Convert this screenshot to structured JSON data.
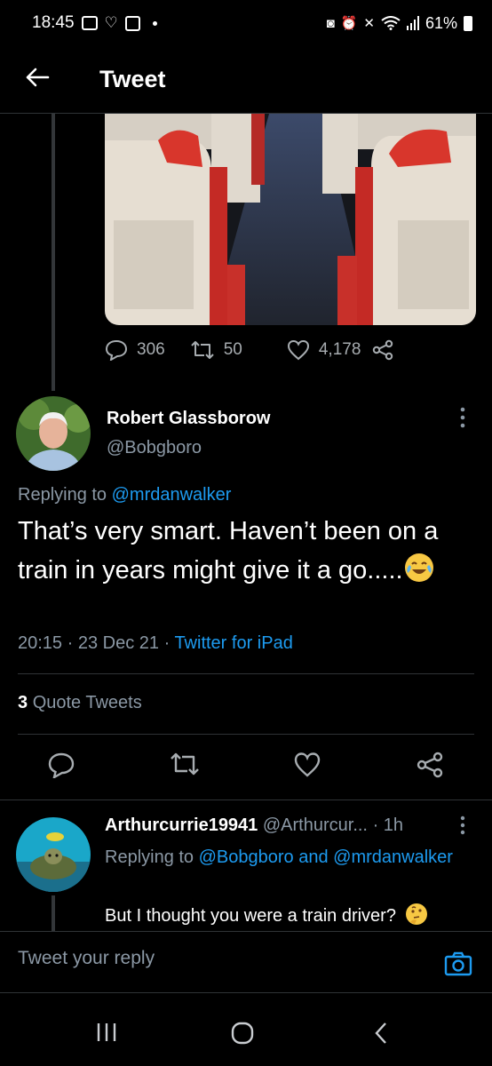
{
  "status_bar": {
    "time": "18:45",
    "battery": "61%"
  },
  "header": {
    "title": "Tweet"
  },
  "previous_tweet": {
    "replies": "306",
    "retweets": "50",
    "likes": "4,178"
  },
  "main_tweet": {
    "name": "Robert Glassborow",
    "handle": "@Bobgboro",
    "replying_prefix": "Replying to",
    "replying_to": "@mrdanwalker",
    "text": "That’s very smart. Haven’t been on a train in years might give it a go.....",
    "emoji": "face-with-tears-of-joy-icon",
    "time": "20:15",
    "date": "23 Dec 21",
    "source": "Twitter for iPad",
    "quote_count": "3",
    "quote_label": "Quote Tweets"
  },
  "reply": {
    "name": "Arthurcurrie19941",
    "handle": "@Arthurcur...",
    "age": "1h",
    "replying_prefix": "Replying to",
    "replying_to_1": "@Bobgboro",
    "replying_and": "and",
    "replying_to_2": "@mrdanwalker",
    "text": "But I thought you were a train driver?",
    "emoji": "thinking-face-icon"
  },
  "compose": {
    "placeholder": "Tweet your reply"
  },
  "colors": {
    "background": "#000000",
    "link": "#1d9bf0",
    "secondary_text": "#8b98a5",
    "divider": "#2f3336"
  }
}
